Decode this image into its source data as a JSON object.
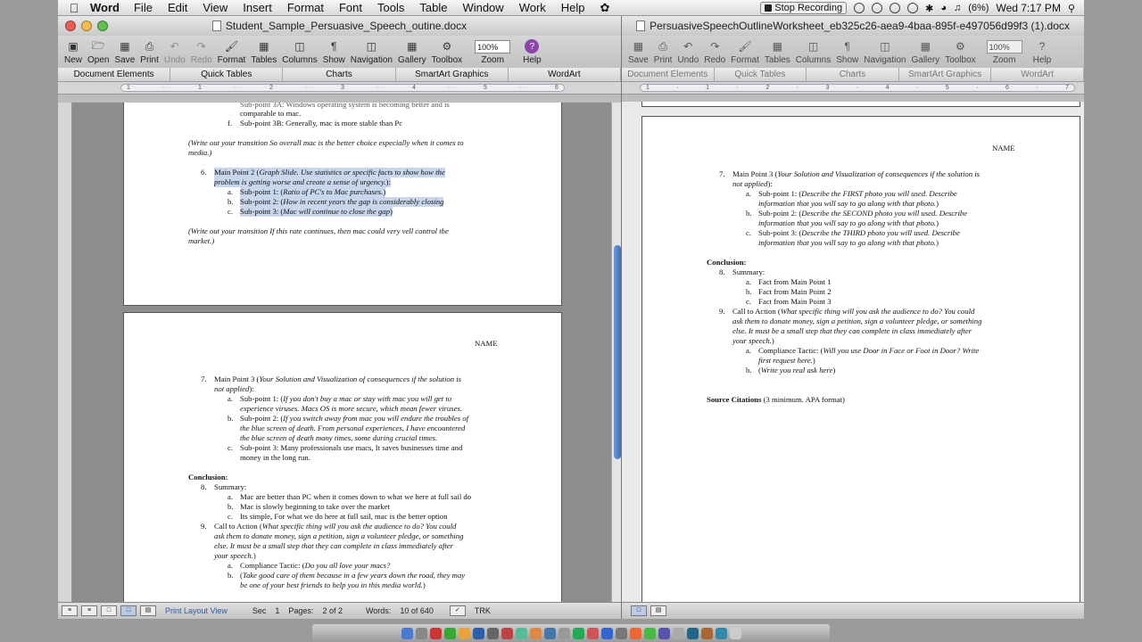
{
  "menubar": {
    "app_name": "Word",
    "items": [
      "File",
      "Edit",
      "View",
      "Insert",
      "Format",
      "Font",
      "Tools",
      "Table",
      "Window",
      "Work",
      "Help"
    ],
    "stop_recording": "Stop Recording",
    "battery": "(6%)",
    "clock": "Wed 7:17 PM"
  },
  "toolbar": {
    "buttons": [
      "New",
      "Open",
      "Save",
      "Print",
      "Undo",
      "Redo",
      "Format",
      "Tables",
      "Columns",
      "Show",
      "Navigation",
      "Gallery",
      "Toolbox",
      "Zoom",
      "Help"
    ],
    "zoom": "100%"
  },
  "toolbar2": {
    "buttons": [
      "Save",
      "Print",
      "Undo",
      "Redo",
      "Format",
      "Tables",
      "Columns",
      "Show",
      "Navigation",
      "Gallery",
      "Toolbox",
      "Zoom",
      "Help"
    ]
  },
  "ribbon": {
    "tabs": [
      "Document Elements",
      "Quick Tables",
      "Charts",
      "SmartArt Graphics",
      "WordArt"
    ]
  },
  "win1": {
    "title": "Student_Sample_Persuasive_Speech_outine.docx",
    "p1": {
      "l1": "Sub-point 3A: Windows operating system is becoming better and is",
      "l2": "comparable to mac.",
      "f_marker": "f.",
      "f_text": "Sub-point 3B:  Generally, mac is more stable than Pc",
      "t1a": "(Write out your transition So overall mac is the better choice especially when it comes to",
      "t1b": "media.)",
      "n6": "6.",
      "mp2_a": "Main Point 2 (",
      "mp2_b": "Graph Slide.  Use statistics or specific facts to show how the",
      "mp2_c": "problem is getting worse and create a sense of urgency.",
      "mp2_d": "):",
      "a": "a.",
      "b": "b.",
      "c": "c.",
      "sp1_a": "Sub-point 1: (",
      "sp1_b": "Ratio of PC's to Mac purchases.",
      "sp1_c": ")",
      "sp2_a": "Sub-point 2: (",
      "sp2_b": "How in recent years the gap is considerably closing",
      "sp3_a": "Sub-point 3:  (",
      "sp3_b": "Mac will continue to close the gap",
      "sp3_c": ")",
      "t2a": "(Write out your transition If this rate continues, then mac could very vell control the",
      "t2b": "market.)"
    },
    "p2": {
      "name": "NAME",
      "n7": "7.",
      "mp3_a": "Main Point 3 (",
      "mp3_b": "Your Solution and Visualization of consequences if the solution is",
      "mp3_c": "not applied",
      "mp3_d": "):",
      "a": "a.",
      "b": "b.",
      "c": "c.",
      "s1a": "Sub-point 1: (",
      "s1b": "If you don't buy a mac or stay with mac you will get to",
      "s1c": "experience viruses. Macs OS is more secure, which mean fewer viruses.",
      "s2a": "Sub-point 2:  (",
      "s2b": "If you switch away from mac you will endure the troubles of",
      "s2c": "the blue screen of death. From personal experiences, I have encountered",
      "s2d": "the blue screen of death many times, some during crucial times.",
      "s3": "Sub-point 3:   Many professionals use macs, It saves businesses time and",
      "s3b": "money in the long run.",
      "conclusion": "Conclusion:",
      "n8": "8.",
      "summary": "Summary:",
      "sa": "Mac are better than PC when it comes down to what we here at full sail do",
      "sb": "Mac is slowly beginning to take over the market",
      "sc": "Its simple, For what we do here at full sail, mac is the better option",
      "n9": "9.",
      "cta_a": "Call to Action (",
      "cta_b": "What specific thing will you ask the audience to do?  You could",
      "cta_c": "ask them to donate money, sign a petition, sign a volunteer pledge, or something",
      "cta_d": "else.  It must be a small step that they can complete in class immediately after",
      "cta_e": "your speech.",
      "cta_f": ")",
      "ct_a": "Compliance Tactic:  (",
      "ct_b": "Do you all love your macs?",
      "tb_a": "(",
      "tb_b": "Take good care of them because in a few years down the road, they may",
      "tb_c": "be one of your best friends to help you in this media world.",
      "tb_d": ")"
    },
    "status": {
      "view": "Print Layout View",
      "sec_label": "Sec",
      "sec": "1",
      "pages_label": "Pages:",
      "pages": "2 of 2",
      "words_label": "Words:",
      "words": "10 of 640",
      "trk": "TRK"
    }
  },
  "win2": {
    "title": "PersuasiveSpeechOutlineWorksheet_eb325c26-aea9-4baa-895f-e497056d99f3 (1).docx",
    "page": {
      "name": "NAME",
      "n7": "7.",
      "mp3_a": "Main Point 3 (",
      "mp3_b": "Your Solution and Visualization of consequences if the solution is",
      "mp3_c": "not applied",
      "mp3_d": "):",
      "a": "a.",
      "b": "b.",
      "c": "c.",
      "s1a": "Sub-point 1: (",
      "s1b": "Describe the FIRST photo you will used.  Describe",
      "s1c": "information that you will say to go along with that photo.",
      "s1d": ")",
      "s2a": "Sub-point 2:  (",
      "s2b": "Describe the SECOND photo you will used.  Describe",
      "s2c": "information that you will say to go along with that photo.",
      "s2d": ")",
      "s3a": "Sub-point 3:  (",
      "s3b": "Describe the THIRD photo you will used.  Describe",
      "s3c": "information that you will say to go along with that photo.",
      "s3d": ")",
      "conclusion": "Conclusion:",
      "n8": "8.",
      "summary": "Summary:",
      "fa": "Fact from Main Point 1",
      "fb": "Fact from Main Point 2",
      "fc": "Fact from Main Point 3",
      "n9": "9.",
      "cta_a": "Call to Action (",
      "cta_b": "What specific thing will you ask the audience to do?  You could",
      "cta_c": "ask them to donate money, sign a petition, sign a volunteer pledge, or something",
      "cta_d": "else.  It must be a small step that they can complete in class immediately after",
      "cta_e": "your speech.",
      "cta_f": ")",
      "ct_a": "Compliance Tactic:  (",
      "ct_b": "Will you use Door in Face or Foot in Door? Write",
      "ct_c": "first request here.",
      "ct_d": ")",
      "b_a": "(",
      "b_b": "Write you real ask here",
      "b_c": ")",
      "src_a": "Source Citations",
      "src_b": " (3 minimum.  APA format)"
    }
  },
  "colors": {
    "highlight": "#c8d7ec",
    "scroll_thumb": "#3d6fbd",
    "help_icon": "#8e44ad"
  }
}
